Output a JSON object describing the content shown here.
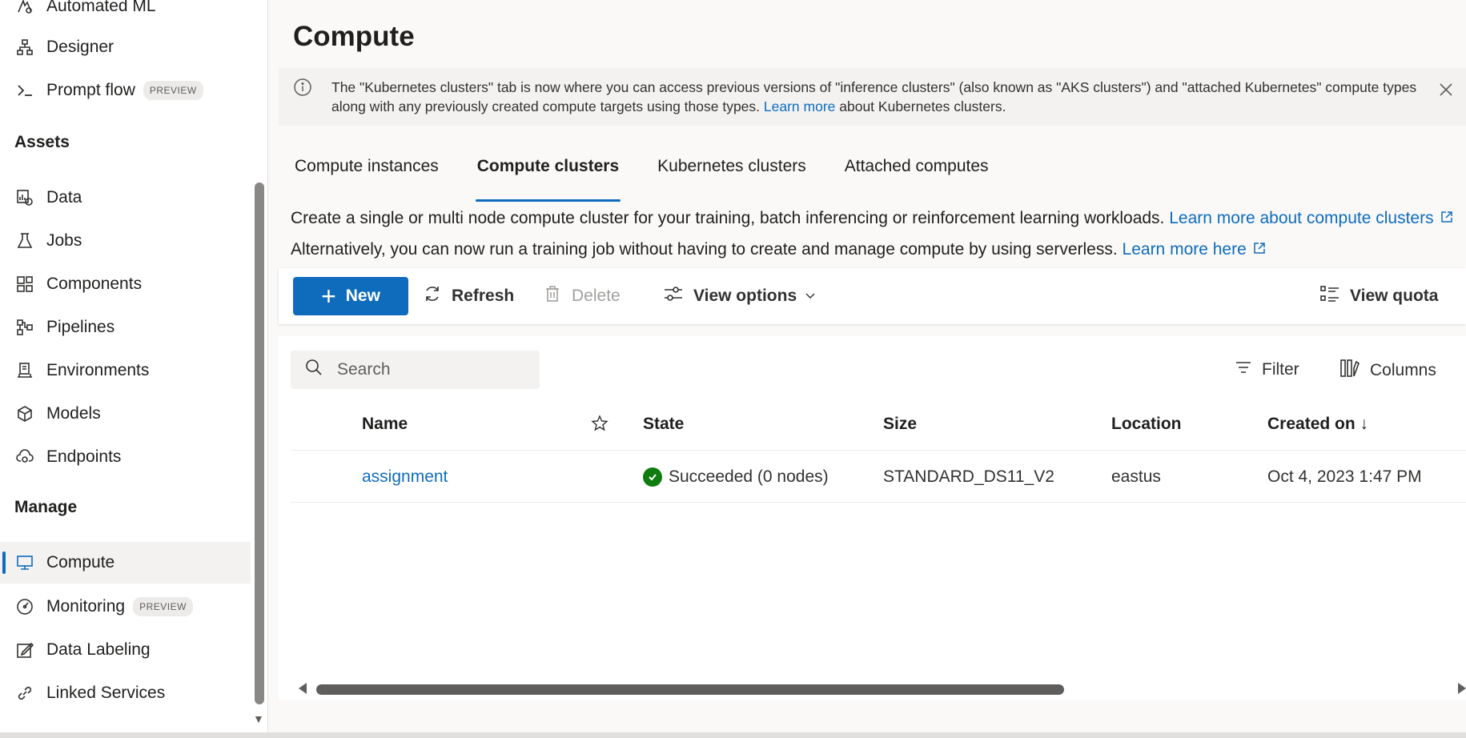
{
  "sidebar": {
    "top_items": [
      {
        "label": "Automated ML",
        "icon": "automated-ml-icon"
      },
      {
        "label": "Designer",
        "icon": "designer-icon"
      },
      {
        "label": "Prompt flow",
        "icon": "prompt-flow-icon",
        "badge": "PREVIEW"
      }
    ],
    "assets_title": "Assets",
    "assets": [
      {
        "label": "Data",
        "icon": "data-icon"
      },
      {
        "label": "Jobs",
        "icon": "jobs-icon"
      },
      {
        "label": "Components",
        "icon": "components-icon"
      },
      {
        "label": "Pipelines",
        "icon": "pipelines-icon"
      },
      {
        "label": "Environments",
        "icon": "environments-icon"
      },
      {
        "label": "Models",
        "icon": "models-icon"
      },
      {
        "label": "Endpoints",
        "icon": "endpoints-icon"
      }
    ],
    "manage_title": "Manage",
    "manage": [
      {
        "label": "Compute",
        "icon": "compute-icon",
        "active": true
      },
      {
        "label": "Monitoring",
        "icon": "monitoring-icon",
        "badge": "PREVIEW"
      },
      {
        "label": "Data Labeling",
        "icon": "data-labeling-icon"
      },
      {
        "label": "Linked Services",
        "icon": "linked-services-icon"
      }
    ]
  },
  "page": {
    "title": "Compute",
    "banner": {
      "text_before": "The \"Kubernetes clusters\" tab is now where you can access previous versions of \"inference clusters\" (also known as \"AKS clusters\") and \"attached Kubernetes\" compute types along with any previously created compute targets using those types. ",
      "link": "Learn more",
      "text_after": " about Kubernetes clusters."
    },
    "tabs": [
      "Compute instances",
      "Compute clusters",
      "Kubernetes clusters",
      "Attached computes"
    ],
    "active_tab": "Compute clusters",
    "desc1": {
      "text": "Create a single or multi node compute cluster for your training, batch inferencing or reinforcement learning workloads. ",
      "link": "Learn more about compute clusters"
    },
    "desc2": {
      "text": "Alternatively, you can now run a training job without having to create and manage compute by using serverless. ",
      "link": "Learn more here"
    }
  },
  "toolbar": {
    "new_label": "New",
    "refresh_label": "Refresh",
    "delete_label": "Delete",
    "view_options_label": "View options",
    "view_quota_label": "View quota"
  },
  "grid": {
    "search_placeholder": "Search",
    "filter_label": "Filter",
    "columns_label": "Columns",
    "headers": {
      "name": "Name",
      "state": "State",
      "size": "Size",
      "location": "Location",
      "created_on": "Created on ↓"
    },
    "rows": [
      {
        "name": "assignment",
        "state": "Succeeded (0 nodes)",
        "size": "STANDARD_DS11_V2",
        "location": "eastus",
        "created_on": "Oct 4, 2023 1:47 PM"
      }
    ]
  },
  "colors": {
    "accent": "#0f6cbd",
    "success": "#107c10"
  }
}
